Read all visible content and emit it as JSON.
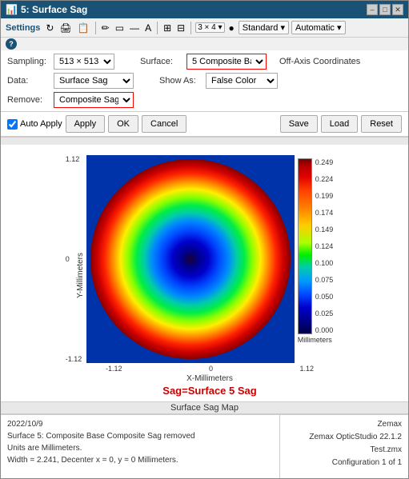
{
  "window": {
    "title": "5: Surface Sag",
    "min_btn": "–",
    "max_btn": "□",
    "close_btn": "✕"
  },
  "settings_toolbar": {
    "settings_label": "Settings",
    "badge_3x4": "3 × 4 ▾",
    "standard_label": "Standard ▾",
    "automatic_label": "Automatic ▾"
  },
  "controls": {
    "sampling_label": "Sampling:",
    "sampling_value": "513 × 513",
    "surface_label": "Surface:",
    "surface_value": "5 Composite Bas",
    "off_axis_label": "Off-Axis Coordinates",
    "data_label": "Data:",
    "data_value": "Surface Sag",
    "show_as_label": "Show As:",
    "show_as_value": "False Color",
    "remove_label": "Remove:",
    "remove_value": "Composite Sag"
  },
  "buttons": {
    "auto_apply_label": "Auto Apply",
    "apply_label": "Apply",
    "ok_label": "OK",
    "cancel_label": "Cancel",
    "save_label": "Save",
    "load_label": "Load",
    "reset_label": "Reset"
  },
  "chart": {
    "y_axis_label": "Y-Millimeters",
    "x_axis_label": "X-Millimeters",
    "y_ticks": [
      "1.12",
      "0",
      "-1.12"
    ],
    "x_ticks": [
      "-1.12",
      "0",
      "1.12"
    ],
    "colorbar_labels": [
      "0.249",
      "0.224",
      "0.199",
      "0.174",
      "0.149",
      "0.124",
      "0.100",
      "0.075",
      "0.050",
      "0.025",
      "0.000"
    ],
    "colorbar_unit": "Millimeters",
    "title": "Sag=Surface 5 Sag",
    "chart_title_bar": "Surface Sag Map"
  },
  "bottom_info": {
    "left_line1": "2022/10/9",
    "left_line2": "Surface 5: Composite Base Composite Sag removed",
    "left_line3": "Units are Millimeters.",
    "left_line4": "",
    "left_line5": "Width = 2.241, Decenter x = 0, y = 0 Millimeters.",
    "right_line1": "Zemax",
    "right_line2": "Zemax OpticStudio 22.1.2",
    "right_line3": "",
    "right_line4": "Test.zmx",
    "right_line5": "Configuration 1 of 1"
  }
}
